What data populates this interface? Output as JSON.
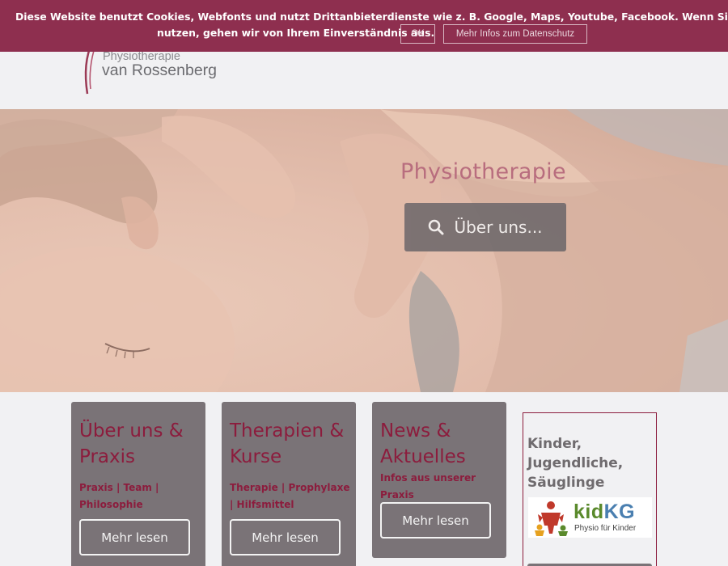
{
  "cookie": {
    "text_line1": "Diese Website benutzt Cookies, Webfonts und nutzt Drittanbieterdienste wie z. B. Google, Maps, Youtube, Facebook. Wenn Sie die Website weiter",
    "text_line2": "nutzen, gehen wir von Ihrem Einverständnis aus.",
    "ok_label": "OK",
    "more_label": "Mehr Infos zum Datenschutz"
  },
  "logo": {
    "line1": "Physiotherapie",
    "line2": "van Rossenberg"
  },
  "hero": {
    "title": "Physiotherapie",
    "button_label": "Über uns..."
  },
  "cards": [
    {
      "title": "Über uns & Praxis",
      "subtitle": "Praxis | Team | Philosophie",
      "button": "Mehr lesen"
    },
    {
      "title": "Therapien & Kurse",
      "subtitle": "Therapie | Prophylaxe | Hilfsmittel",
      "button": "Mehr lesen"
    },
    {
      "title": "News & Aktuelles",
      "subtitle": "Infos aus unserer Praxis",
      "button": "Mehr lesen"
    }
  ],
  "kids": {
    "title": "Kinder, Jugendliche, Säuglinge",
    "logo_kid": "kid",
    "logo_kg": "KG",
    "logo_slogan": "Physio für Kinder"
  },
  "colors": {
    "brand": "#8c1c3d",
    "cookie_bar": "#8e2f4f",
    "card_bg": "#7a7377"
  }
}
